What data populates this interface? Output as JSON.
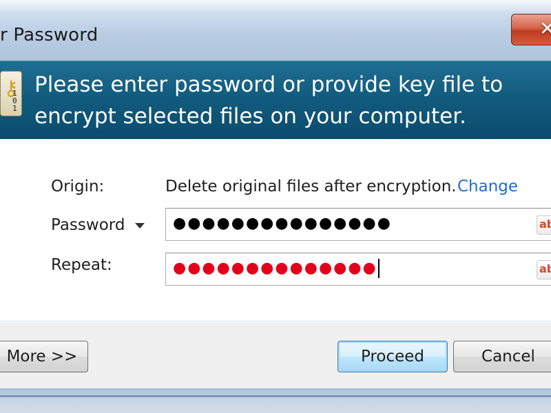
{
  "window": {
    "title": "r Password",
    "close_glyph": "✕"
  },
  "banner": {
    "icon": "encryption-keys-icon",
    "icon_bits": "1\n0\n1",
    "message": "Please enter password or provide key file to encrypt selected files on your computer."
  },
  "form": {
    "origin_label": "Origin:",
    "origin_value": "Delete original files after encryption.",
    "change_link": "Change",
    "password_label": "Password",
    "password_value": "●●●●●●●●●●●●●●●",
    "repeat_label": "Repeat:",
    "repeat_value": "●●●●●●●●●●●●●●",
    "ab_glyph": "ab"
  },
  "buttons": {
    "more": "More >>",
    "proceed": "Proceed",
    "cancel": "Cancel"
  },
  "colors": {
    "banner": "#125b7e",
    "link": "#1f6fc8",
    "repeat_mismatch": "#e3001b"
  }
}
